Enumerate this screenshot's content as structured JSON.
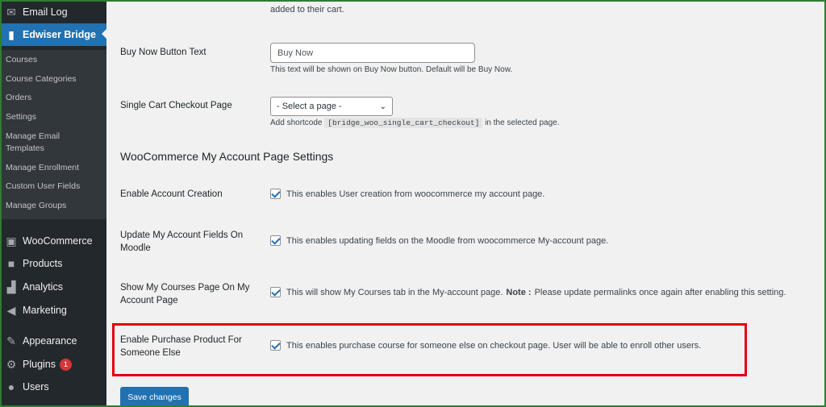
{
  "sidebar": {
    "top_items": [
      {
        "label": "Email Log",
        "icon": "envelope-icon"
      },
      {
        "label": "Edwiser Bridge",
        "icon": "book-icon"
      }
    ],
    "submenu": [
      "Courses",
      "Course Categories",
      "Orders",
      "Settings",
      "Manage Email Templates",
      "Manage Enrollment",
      "Custom User Fields",
      "Manage Groups"
    ],
    "bottom_items": [
      {
        "label": "WooCommerce",
        "icon": "woo-icon"
      },
      {
        "label": "Products",
        "icon": "box-icon"
      },
      {
        "label": "Analytics",
        "icon": "bar-chart-icon"
      },
      {
        "label": "Marketing",
        "icon": "megaphone-icon"
      },
      {
        "label": "Appearance",
        "icon": "brush-icon"
      },
      {
        "label": "Plugins",
        "icon": "plug-icon",
        "badge": "1"
      },
      {
        "label": "Users",
        "icon": "user-icon"
      }
    ]
  },
  "main": {
    "top_cut_text": "added to their cart.",
    "buy_now": {
      "label": "Buy Now Button Text",
      "value": "Buy Now",
      "desc": "This text will be shown on Buy Now button. Default will be Buy Now."
    },
    "checkout": {
      "label": "Single Cart Checkout Page",
      "selected": "- Select a page -",
      "desc_prefix": "Add shortcode",
      "shortcode": "[bridge_woo_single_cart_checkout]",
      "desc_suffix": "in the selected page."
    },
    "section_title": "WooCommerce My Account Page Settings",
    "settings": [
      {
        "label": "Enable Account Creation",
        "desc": "This enables User creation from woocommerce my account page.",
        "checked": true
      },
      {
        "label": "Update My Account Fields On Moodle",
        "desc": "This enables updating fields on the Moodle from woocommerce My-account page.",
        "checked": true
      },
      {
        "label": "Show My Courses Page On My Account Page",
        "desc": "This will show My Courses tab in the My-account page.",
        "note_label": "Note :",
        "note_text": "Please update permalinks once again after enabling this setting.",
        "checked": true
      },
      {
        "label": "Enable Purchase Product For Someone Else",
        "desc": "This enables purchase course for someone else on checkout page. User will be able to enroll other users.",
        "checked": true
      }
    ],
    "save_label": "Save changes"
  },
  "colors": {
    "sidebar_bg": "#23282d",
    "active": "#2271b1",
    "highlight": "#e0000b",
    "frame": "#2e7d32"
  }
}
